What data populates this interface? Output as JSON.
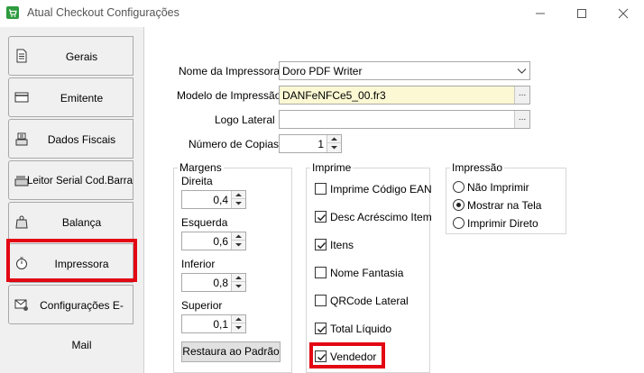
{
  "window": {
    "title": "Atual Checkout Configurações",
    "controls": [
      "minimize",
      "maximize",
      "close"
    ]
  },
  "sidebar": {
    "items": [
      {
        "label": "Gerais",
        "icon": "document-icon"
      },
      {
        "label": "Emitente",
        "icon": "card-icon"
      },
      {
        "label": "Dados Fiscais",
        "icon": "scale-icon"
      },
      {
        "label": "Leitor Serial Cod.Barra",
        "icon": "barcode-reader-icon"
      },
      {
        "label": "Balança",
        "icon": "weight-icon"
      },
      {
        "label": "Impressora",
        "icon": "stopwatch-printer-icon",
        "active": true
      },
      {
        "label": "Configurações E-Mail",
        "icon": "email-settings-icon"
      }
    ]
  },
  "form": {
    "nome_impressora": {
      "label": "Nome da Impressora",
      "value": "Doro PDF Writer"
    },
    "modelo_impressao": {
      "label": "Modelo de Impressão",
      "value": "DANFeNFCe5_00.fr3"
    },
    "logo_lateral": {
      "label": "Logo Lateral",
      "value": ""
    },
    "numero_copias": {
      "label": "Número de Copias",
      "value": "1"
    },
    "ellipsis": "..."
  },
  "margens": {
    "title": "Margens",
    "direita": {
      "label": "Direita",
      "value": "0,4"
    },
    "esquerda": {
      "label": "Esquerda",
      "value": "0,6"
    },
    "inferior": {
      "label": "Inferior",
      "value": "0,8"
    },
    "superior": {
      "label": "Superior",
      "value": "0,1"
    },
    "restore_button": "Restaura ao Padrão"
  },
  "imprime": {
    "title": "Imprime",
    "options": [
      {
        "label": "Imprime Código EAN",
        "checked": false
      },
      {
        "label": "Desc Acréscimo Item",
        "checked": true
      },
      {
        "label": "Itens",
        "checked": true
      },
      {
        "label": "Nome Fantasia",
        "checked": false
      },
      {
        "label": "QRCode Lateral",
        "checked": false
      },
      {
        "label": "Total Líquido",
        "checked": true
      },
      {
        "label": "Vendedor",
        "checked": true
      }
    ]
  },
  "impressao": {
    "title": "Impressão",
    "options": [
      {
        "label": "Não Imprimir",
        "selected": false
      },
      {
        "label": "Mostrar na Tela",
        "selected": true
      },
      {
        "label": "Imprimir Direto",
        "selected": false
      }
    ]
  },
  "colors": {
    "highlight": "#e30613",
    "yellow_field": "#fbf8d3",
    "app_icon_green": "#2e9b3e"
  }
}
